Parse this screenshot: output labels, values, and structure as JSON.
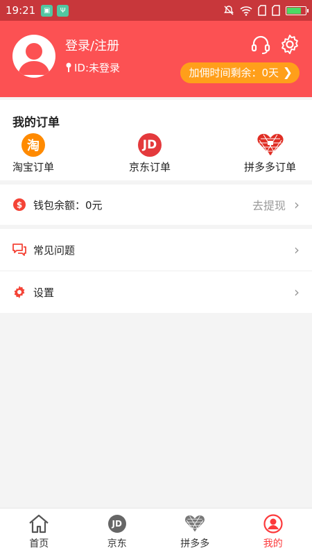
{
  "status_bar": {
    "time": "19:21"
  },
  "header": {
    "login_label": "登录/注册",
    "user_id": "ID:未登录",
    "commission_label": "加佣时间剩余：0天",
    "colors": {
      "header_bg": "#fc5153",
      "badge_bg": "#ff9f1a"
    }
  },
  "orders": {
    "title": "我的订单",
    "items": [
      {
        "label": "淘宝订单",
        "icon": "taobao-icon",
        "glyph": "淘"
      },
      {
        "label": "京东订单",
        "icon": "jd-icon",
        "glyph": "JD"
      },
      {
        "label": "拼多多订单",
        "icon": "pinduoduo-icon"
      }
    ]
  },
  "wallet": {
    "label": "钱包余额：0元",
    "action": "去提现"
  },
  "menu": {
    "faq_label": "常见问题",
    "settings_label": "设置"
  },
  "tabbar": {
    "items": [
      {
        "label": "首页",
        "icon": "home-icon"
      },
      {
        "label": "京东",
        "icon": "jd-icon",
        "glyph": "JD"
      },
      {
        "label": "拼多多",
        "icon": "pinduoduo-icon"
      },
      {
        "label": "我的",
        "icon": "profile-icon",
        "active": true
      }
    ],
    "active_color": "#fc3a3c"
  }
}
